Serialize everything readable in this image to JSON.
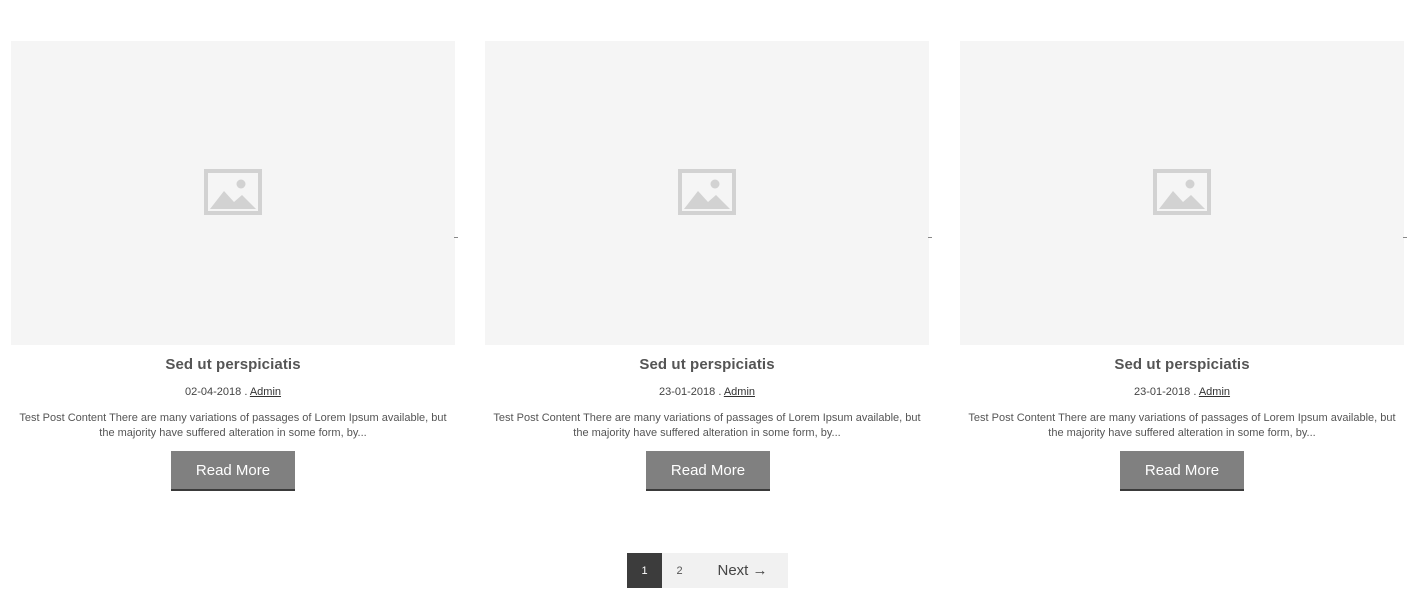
{
  "posts": [
    {
      "title": "Sed ut perspiciatis",
      "date": "02-04-2018",
      "separator": " . ",
      "author": "Admin",
      "excerpt": "Test Post Content There are many variations of passages of Lorem Ipsum available, but the majority have suffered alteration in some form, by...",
      "button_label": "Read More",
      "thumbnail_icon": "image-placeholder-icon"
    },
    {
      "title": "Sed ut perspiciatis",
      "date": "23-01-2018",
      "separator": " . ",
      "author": "Admin",
      "excerpt": "Test Post Content There are many variations of passages of Lorem Ipsum available, but the majority have suffered alteration in some form, by...",
      "button_label": "Read More",
      "thumbnail_icon": "image-placeholder-icon"
    },
    {
      "title": "Sed ut perspiciatis",
      "date": "23-01-2018",
      "separator": " . ",
      "author": "Admin",
      "excerpt": "Test Post Content There are many variations of passages of Lorem Ipsum available, but the majority have suffered alteration in some form, by...",
      "button_label": "Read More",
      "thumbnail_icon": "image-placeholder-icon"
    }
  ],
  "pagination": {
    "current": "1",
    "page_2": "2",
    "next_label": "Next →"
  },
  "colors": {
    "thumbnail_bg": "#f5f5f5",
    "button_bg": "#808080",
    "button_border": "#3a3a3a",
    "pagination_current_bg": "#3c3c3c",
    "pagination_bg": "#f1f1f1"
  }
}
